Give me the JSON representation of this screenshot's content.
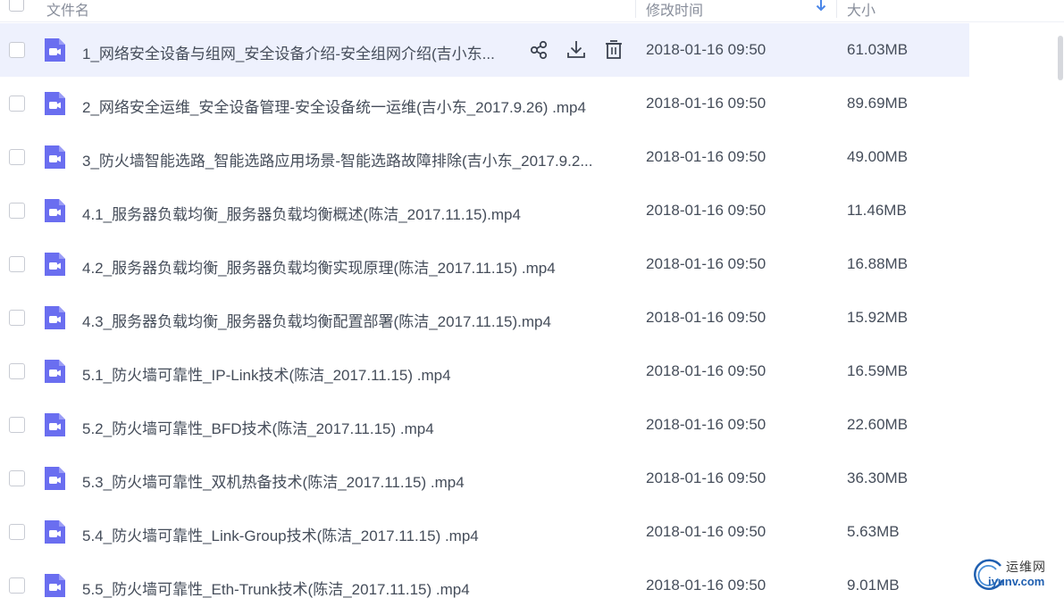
{
  "header": {
    "col_name": "文件名",
    "col_time": "修改时间",
    "col_size": "大小",
    "sort_icon": "sort-down-arrow-icon"
  },
  "colors": {
    "accent": "#4a86e8",
    "file_icon": "#6a6ef0",
    "selected_row_bg": "#eef1fd",
    "watermark_blue": "#1f5fb0"
  },
  "files": [
    {
      "name": "1_网络安全设备与组网_安全设备介绍-安全组网介绍(吉小东...",
      "time": "2018-01-16 09:50",
      "size": "61.03MB",
      "icon": "video-file-icon"
    },
    {
      "name": "2_网络安全运维_安全设备管理-安全设备统一运维(吉小东_2017.9.26) .mp4",
      "time": "2018-01-16 09:50",
      "size": "89.69MB",
      "icon": "video-file-icon"
    },
    {
      "name": "3_防火墙智能选路_智能选路应用场景-智能选路故障排除(吉小东_2017.9.2...",
      "time": "2018-01-16 09:50",
      "size": "49.00MB",
      "icon": "video-file-icon"
    },
    {
      "name": "4.1_服务器负载均衡_服务器负载均衡概述(陈洁_2017.11.15).mp4",
      "time": "2018-01-16 09:50",
      "size": "11.46MB",
      "icon": "video-file-icon"
    },
    {
      "name": "4.2_服务器负载均衡_服务器负载均衡实现原理(陈洁_2017.11.15) .mp4",
      "time": "2018-01-16 09:50",
      "size": "16.88MB",
      "icon": "video-file-icon"
    },
    {
      "name": "4.3_服务器负载均衡_服务器负载均衡配置部署(陈洁_2017.11.15).mp4",
      "time": "2018-01-16 09:50",
      "size": "15.92MB",
      "icon": "video-file-icon"
    },
    {
      "name": "5.1_防火墙可靠性_IP-Link技术(陈洁_2017.11.15) .mp4",
      "time": "2018-01-16 09:50",
      "size": "16.59MB",
      "icon": "video-file-icon"
    },
    {
      "name": "5.2_防火墙可靠性_BFD技术(陈洁_2017.11.15) .mp4",
      "time": "2018-01-16 09:50",
      "size": "22.60MB",
      "icon": "video-file-icon"
    },
    {
      "name": "5.3_防火墙可靠性_双机热备技术(陈洁_2017.11.15) .mp4",
      "time": "2018-01-16 09:50",
      "size": "36.30MB",
      "icon": "video-file-icon"
    },
    {
      "name": "5.4_防火墙可靠性_Link-Group技术(陈洁_2017.11.15) .mp4",
      "time": "2018-01-16 09:50",
      "size": "5.63MB",
      "icon": "video-file-icon"
    },
    {
      "name": "5.5_防火墙可靠性_Eth-Trunk技术(陈洁_2017.11.15) .mp4",
      "time": "2018-01-16 09:50",
      "size": "9.01MB",
      "icon": "video-file-icon"
    }
  ],
  "row_actions": {
    "share_icon": "share-icon",
    "download_icon": "download-icon",
    "delete_icon": "delete-icon"
  },
  "watermark": {
    "top": "运维网",
    "bottom": "iyunv.com"
  }
}
